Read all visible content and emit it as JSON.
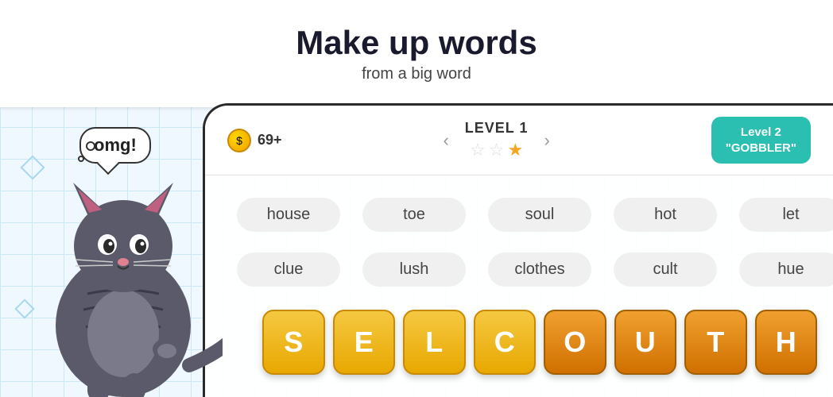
{
  "page": {
    "title": "Make up words",
    "subtitle": "from a big word"
  },
  "header": {
    "coin_count": "69+",
    "level_label": "LEVEL 1",
    "stars": [
      false,
      false,
      true
    ],
    "nav_left": "‹",
    "nav_right": "›",
    "next_level_text": "Level 2",
    "next_level_word": "\"GOBBLER\""
  },
  "words": [
    {
      "text": "house",
      "row": 0,
      "col": 0
    },
    {
      "text": "toe",
      "row": 0,
      "col": 1
    },
    {
      "text": "soul",
      "row": 0,
      "col": 2
    },
    {
      "text": "hot",
      "row": 0,
      "col": 3
    },
    {
      "text": "let",
      "row": 0,
      "col": 4
    },
    {
      "text": "clue",
      "row": 1,
      "col": 0
    },
    {
      "text": "lush",
      "row": 1,
      "col": 1
    },
    {
      "text": "clothes",
      "row": 1,
      "col": 2
    },
    {
      "text": "cult",
      "row": 1,
      "col": 3
    },
    {
      "text": "hue",
      "row": 1,
      "col": 4
    }
  ],
  "tiles": [
    {
      "letter": "S",
      "type": "yellow"
    },
    {
      "letter": "E",
      "type": "yellow"
    },
    {
      "letter": "L",
      "type": "yellow"
    },
    {
      "letter": "C",
      "type": "yellow"
    },
    {
      "letter": "O",
      "type": "orange"
    },
    {
      "letter": "U",
      "type": "orange"
    },
    {
      "letter": "T",
      "type": "orange"
    },
    {
      "letter": "H",
      "type": "orange"
    }
  ],
  "cat": {
    "speech": "omg!"
  },
  "colors": {
    "accent_teal": "#2abfb0",
    "tile_yellow": "#f5c842",
    "tile_orange": "#f0a030",
    "star_filled": "#f5a623",
    "panel_bg": "white"
  }
}
